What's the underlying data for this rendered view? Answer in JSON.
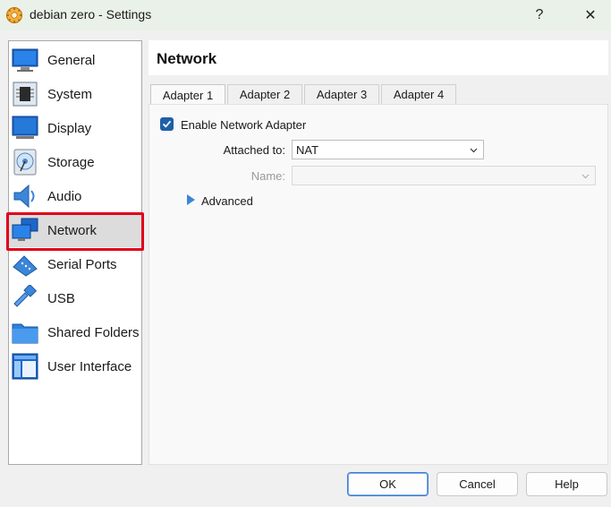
{
  "window": {
    "title": "debian zero - Settings",
    "help_glyph": "?",
    "close_glyph": "✕",
    "app_icon": "virtualbox-gear-icon"
  },
  "sidebar": {
    "items": [
      {
        "label": "General",
        "icon": "monitor-icon"
      },
      {
        "label": "System",
        "icon": "chip-icon"
      },
      {
        "label": "Display",
        "icon": "display-icon"
      },
      {
        "label": "Storage",
        "icon": "disk-icon"
      },
      {
        "label": "Audio",
        "icon": "speaker-icon"
      },
      {
        "label": "Network",
        "icon": "network-icon"
      },
      {
        "label": "Serial Ports",
        "icon": "serial-port-icon"
      },
      {
        "label": "USB",
        "icon": "usb-icon"
      },
      {
        "label": "Shared Folders",
        "icon": "folder-icon"
      },
      {
        "label": "User Interface",
        "icon": "ui-window-icon"
      }
    ],
    "selected": "Network",
    "highlight_color": "#e0001b"
  },
  "main": {
    "title": "Network",
    "tabs": [
      "Adapter 1",
      "Adapter 2",
      "Adapter 3",
      "Adapter 4"
    ],
    "active_tab": "Adapter 1",
    "enable_label": "Enable Network Adapter",
    "enable_checked": true,
    "attached_label": "Attached to:",
    "attached_value": "NAT",
    "name_label": "Name:",
    "name_value": "",
    "advanced_label": "Advanced"
  },
  "buttons": {
    "ok": "OK",
    "cancel": "Cancel",
    "help": "Help"
  },
  "colors": {
    "accent": "#1f5fa8",
    "titlebar": "#eaf1e8"
  }
}
